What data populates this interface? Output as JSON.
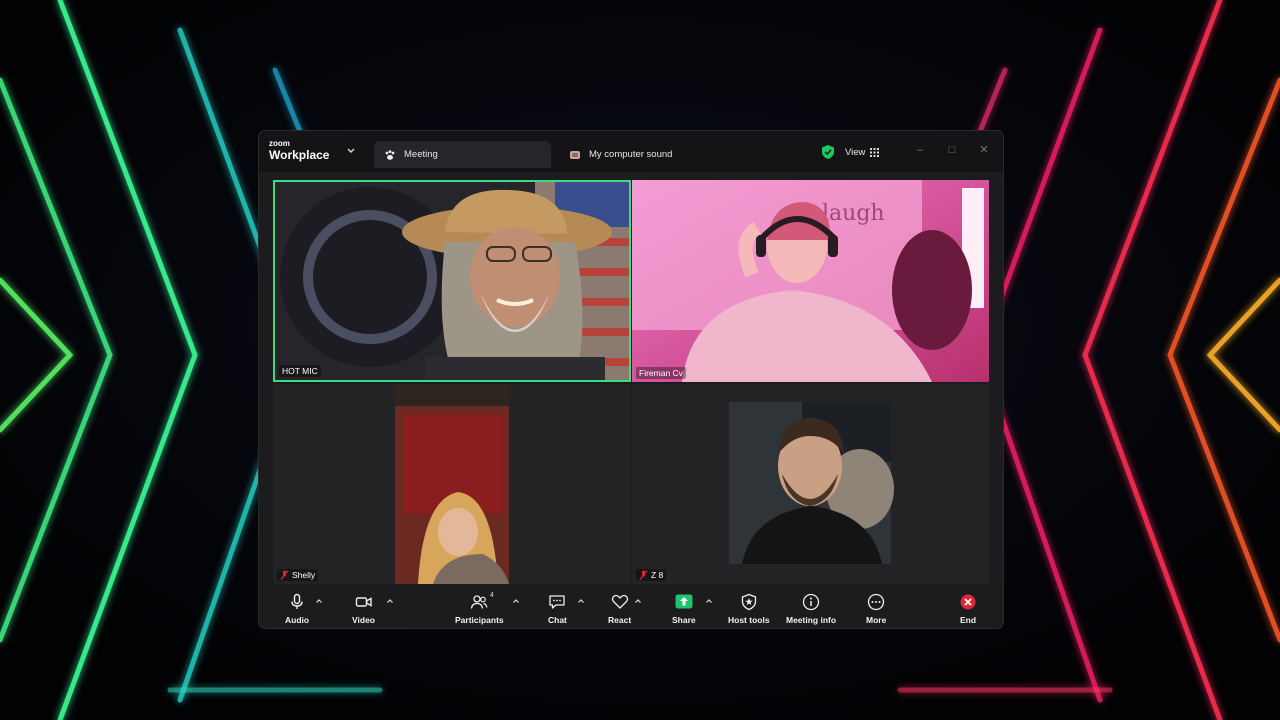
{
  "app": {
    "brand_small": "zoom",
    "brand_name": "Workplace"
  },
  "tabs": {
    "meeting_label": "Meeting",
    "sound_label": "My computer sound"
  },
  "header": {
    "view_label": "View"
  },
  "participants": [
    {
      "name": "HOT MIC",
      "active_speaker": true,
      "muted": false
    },
    {
      "name": "Fireman Cv",
      "active_speaker": false,
      "muted": false
    },
    {
      "name": "Shelly",
      "active_speaker": false,
      "muted": true
    },
    {
      "name": "Z 8",
      "active_speaker": false,
      "muted": true
    }
  ],
  "toolbar": {
    "audio_label": "Audio",
    "video_label": "Video",
    "participants_label": "Participants",
    "participants_count": "4",
    "chat_label": "Chat",
    "react_label": "React",
    "share_label": "Share",
    "host_tools_label": "Host tools",
    "meeting_info_label": "Meeting info",
    "more_label": "More",
    "end_label": "End"
  },
  "colors": {
    "active_speaker_border": "#3ddc84",
    "share_green": "#1fc36b",
    "end_red": "#e0263a",
    "shield_green": "#1ec85b"
  }
}
